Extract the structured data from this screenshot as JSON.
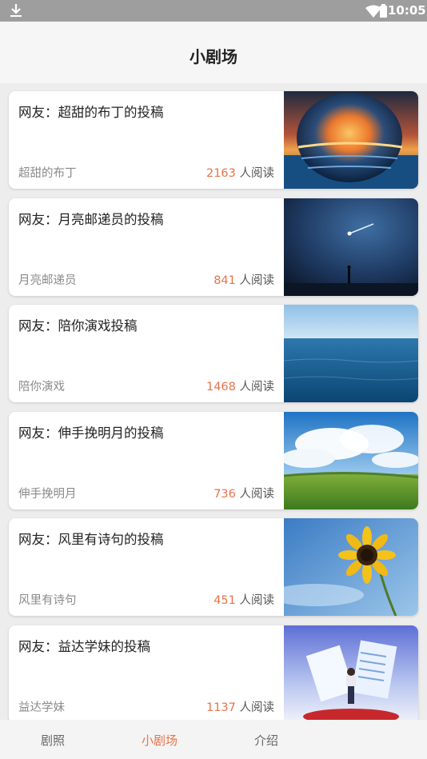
{
  "status_bar": {
    "time": "10:05"
  },
  "header": {
    "title": "小剧场"
  },
  "reads_suffix": "人阅读",
  "cards": [
    {
      "title": "网友：超甜的布丁的投稿",
      "author": "超甜的布丁",
      "reads": "2163",
      "image": "sunset-sphere-image"
    },
    {
      "title": "网友：月亮邮递员的投稿",
      "author": "月亮邮递员",
      "reads": "841",
      "image": "night-sky-meteor-image"
    },
    {
      "title": "网友：陪你演戏投稿",
      "author": "陪你演戏",
      "reads": "1468",
      "image": "ocean-horizon-image"
    },
    {
      "title": "网友：伸手挽明月的投稿",
      "author": "伸手挽明月",
      "reads": "736",
      "image": "grassland-clouds-image"
    },
    {
      "title": "网友：风里有诗句的投稿",
      "author": "风里有诗句",
      "reads": "451",
      "image": "sunflower-sky-image"
    },
    {
      "title": "网友：益达学妹的投稿",
      "author": "益达学妹",
      "reads": "1137",
      "image": "illustration-paper-image"
    }
  ],
  "tabs": [
    {
      "label": "剧照",
      "active": false
    },
    {
      "label": "小剧场",
      "active": true
    },
    {
      "label": "介绍",
      "active": false
    }
  ],
  "colors": {
    "accent": "#e8734b",
    "status_bar": "#9e9e9e"
  }
}
